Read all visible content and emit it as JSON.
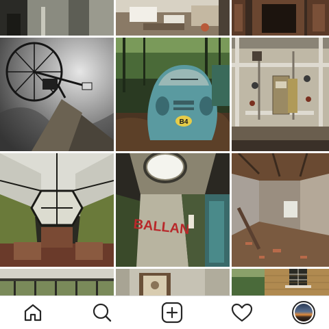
{
  "grid": {
    "tiles": [
      {
        "name": "photo-tile-abandoned-tower-corner",
        "caption": ""
      },
      {
        "name": "photo-tile-cluttered-room",
        "caption": ""
      },
      {
        "name": "photo-tile-ornate-fireplace",
        "caption": ""
      },
      {
        "name": "photo-tile-satellite-dish",
        "caption": ""
      },
      {
        "name": "photo-tile-beetle-car",
        "caption": ""
      },
      {
        "name": "photo-tile-boiler-room-pipes",
        "caption": ""
      },
      {
        "name": "photo-tile-geometric-dome-room",
        "caption": ""
      },
      {
        "name": "photo-tile-graffiti-corridor",
        "caption": ""
      },
      {
        "name": "photo-tile-collapsed-room",
        "caption": ""
      },
      {
        "name": "photo-tile-window-ledge",
        "caption": ""
      },
      {
        "name": "photo-tile-framed-picture-wall",
        "caption": ""
      },
      {
        "name": "photo-tile-brick-facade",
        "caption": ""
      }
    ],
    "car_plate_text": "B4",
    "graffiti_text": "BALLAN"
  },
  "bottom_nav": {
    "items": [
      {
        "id": "home",
        "icon": "home-icon"
      },
      {
        "id": "search",
        "icon": "search-icon"
      },
      {
        "id": "add",
        "icon": "add-post-icon"
      },
      {
        "id": "activity",
        "icon": "heart-icon"
      },
      {
        "id": "profile",
        "icon": "profile-avatar"
      }
    ]
  },
  "colors": {
    "nav_background": "#ffffff",
    "nav_border": "#dbdbdb",
    "icon_stroke": "#262626"
  }
}
